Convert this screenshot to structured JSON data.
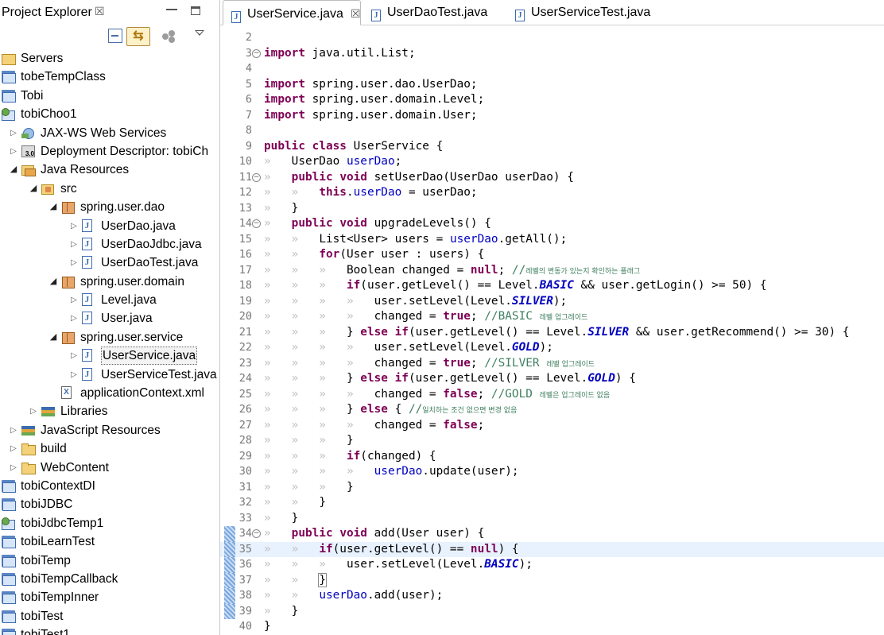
{
  "explorer": {
    "title": "Project Explorer",
    "tree": [
      {
        "label": "Servers",
        "icon": "server-folder",
        "level": 0,
        "twisty": "none"
      },
      {
        "label": "tobeTempClass",
        "icon": "folder-project",
        "level": 0,
        "twisty": "none"
      },
      {
        "label": "Tobi",
        "icon": "folder-project",
        "level": 0,
        "twisty": "none"
      },
      {
        "label": "tobiChoo1",
        "icon": "web-project",
        "level": 0,
        "twisty": "none"
      },
      {
        "label": "JAX-WS Web Services",
        "icon": "jaxws",
        "level": 1,
        "twisty": "collapsed"
      },
      {
        "label": "Deployment Descriptor: tobiCh",
        "icon": "descriptor",
        "level": 1,
        "twisty": "collapsed"
      },
      {
        "label": "Java Resources",
        "icon": "java-res",
        "level": 1,
        "twisty": "expanded"
      },
      {
        "label": "src",
        "icon": "src-folder",
        "level": 2,
        "twisty": "expanded"
      },
      {
        "label": "spring.user.dao",
        "icon": "package",
        "level": 3,
        "twisty": "expanded"
      },
      {
        "label": "UserDao.java",
        "icon": "java-file",
        "level": 4,
        "twisty": "collapsed"
      },
      {
        "label": "UserDaoJdbc.java",
        "icon": "java-file",
        "level": 4,
        "twisty": "collapsed"
      },
      {
        "label": "UserDaoTest.java",
        "icon": "java-file",
        "level": 4,
        "twisty": "collapsed"
      },
      {
        "label": "spring.user.domain",
        "icon": "package",
        "level": 3,
        "twisty": "expanded"
      },
      {
        "label": "Level.java",
        "icon": "java-file",
        "level": 4,
        "twisty": "collapsed"
      },
      {
        "label": "User.java",
        "icon": "java-file",
        "level": 4,
        "twisty": "collapsed"
      },
      {
        "label": "spring.user.service",
        "icon": "package",
        "level": 3,
        "twisty": "expanded"
      },
      {
        "label": "UserService.java",
        "icon": "java-file",
        "level": 4,
        "twisty": "collapsed",
        "selected": true
      },
      {
        "label": "UserServiceTest.java",
        "icon": "java-file",
        "level": 4,
        "twisty": "collapsed"
      },
      {
        "label": "applicationContext.xml",
        "icon": "xml-file",
        "level": 3,
        "twisty": "none"
      },
      {
        "label": "Libraries",
        "icon": "library",
        "level": 2,
        "twisty": "collapsed"
      },
      {
        "label": "JavaScript Resources",
        "icon": "js-res",
        "level": 1,
        "twisty": "collapsed"
      },
      {
        "label": "build",
        "icon": "closed-folder",
        "level": 1,
        "twisty": "collapsed"
      },
      {
        "label": "WebContent",
        "icon": "closed-folder",
        "level": 1,
        "twisty": "collapsed"
      },
      {
        "label": "tobiContextDI",
        "icon": "folder-project",
        "level": 0,
        "twisty": "none"
      },
      {
        "label": "tobiJDBC",
        "icon": "folder-project",
        "level": 0,
        "twisty": "none"
      },
      {
        "label": "tobiJdbcTemp1",
        "icon": "web-project",
        "level": 0,
        "twisty": "none"
      },
      {
        "label": "tobiLearnTest",
        "icon": "folder-project",
        "level": 0,
        "twisty": "none"
      },
      {
        "label": "tobiTemp",
        "icon": "folder-project",
        "level": 0,
        "twisty": "none"
      },
      {
        "label": "tobiTempCallback",
        "icon": "folder-project",
        "level": 0,
        "twisty": "none"
      },
      {
        "label": "tobiTempInner",
        "icon": "folder-project",
        "level": 0,
        "twisty": "none"
      },
      {
        "label": "tobiTest",
        "icon": "folder-project",
        "level": 0,
        "twisty": "none"
      },
      {
        "label": "tobiTest1",
        "icon": "folder-project",
        "level": 0,
        "twisty": "none"
      }
    ]
  },
  "editor": {
    "tabs": [
      {
        "label": "UserService.java",
        "active": true,
        "closable": true
      },
      {
        "label": "UserDaoTest.java",
        "active": false,
        "closable": false
      },
      {
        "label": "UserServiceTest.java",
        "active": false,
        "closable": false
      }
    ],
    "current_line": 35,
    "lines": [
      {
        "n": 2,
        "t": []
      },
      {
        "n": 3,
        "fold": "minus",
        "t": [
          [
            "kw",
            "import"
          ],
          [
            "p",
            " java.util.List;"
          ]
        ]
      },
      {
        "n": 4,
        "t": []
      },
      {
        "n": 5,
        "t": [
          [
            "kw",
            "import"
          ],
          [
            "p",
            " spring.user.dao.UserDao;"
          ]
        ]
      },
      {
        "n": 6,
        "t": [
          [
            "kw",
            "import"
          ],
          [
            "p",
            " spring.user.domain.Level;"
          ]
        ]
      },
      {
        "n": 7,
        "t": [
          [
            "kw",
            "import"
          ],
          [
            "p",
            " spring.user.domain.User;"
          ]
        ]
      },
      {
        "n": 8,
        "t": []
      },
      {
        "n": 9,
        "t": [
          [
            "kw",
            "public"
          ],
          [
            "p",
            " "
          ],
          [
            "kw",
            "class"
          ],
          [
            "p",
            " UserService {"
          ]
        ]
      },
      {
        "n": 10,
        "t": [
          [
            "tab",
            "»   "
          ],
          [
            "p",
            "UserDao "
          ],
          [
            "fld",
            "userDao"
          ],
          [
            "p",
            ";"
          ]
        ]
      },
      {
        "n": 11,
        "fold": "minus",
        "t": [
          [
            "tab",
            "»   "
          ],
          [
            "kw",
            "public"
          ],
          [
            "p",
            " "
          ],
          [
            "kw",
            "void"
          ],
          [
            "p",
            " setUserDao(UserDao userDao) {"
          ]
        ]
      },
      {
        "n": 12,
        "t": [
          [
            "tab",
            "»   »   "
          ],
          [
            "kw",
            "this"
          ],
          [
            "p",
            "."
          ],
          [
            "fld",
            "userDao"
          ],
          [
            "p",
            " = userDao;"
          ]
        ]
      },
      {
        "n": 13,
        "t": [
          [
            "tab",
            "»   "
          ],
          [
            "p",
            "}"
          ]
        ]
      },
      {
        "n": 14,
        "fold": "minus",
        "t": [
          [
            "tab",
            "»   "
          ],
          [
            "kw",
            "public"
          ],
          [
            "p",
            " "
          ],
          [
            "kw",
            "void"
          ],
          [
            "p",
            " upgradeLevels() {"
          ]
        ]
      },
      {
        "n": 15,
        "t": [
          [
            "tab",
            "»   »   "
          ],
          [
            "p",
            "List<User> users = "
          ],
          [
            "fld",
            "userDao"
          ],
          [
            "p",
            ".getAll();"
          ]
        ]
      },
      {
        "n": 16,
        "t": [
          [
            "tab",
            "»   »   "
          ],
          [
            "kw",
            "for"
          ],
          [
            "p",
            "(User user : users) {"
          ]
        ]
      },
      {
        "n": 17,
        "t": [
          [
            "tab",
            "»   »   »   "
          ],
          [
            "p",
            "Boolean changed = "
          ],
          [
            "kw",
            "null"
          ],
          [
            "p",
            "; "
          ],
          [
            "cmt",
            "//"
          ],
          [
            "ctext",
            "레벨의 변동가 있는지 확인하는 플래그"
          ]
        ]
      },
      {
        "n": 18,
        "t": [
          [
            "tab",
            "»   »   »   "
          ],
          [
            "kw",
            "if"
          ],
          [
            "p",
            "(user.getLevel() == Level."
          ],
          [
            "sfld",
            "BASIC"
          ],
          [
            "p",
            " && user.getLogin() >= 50) {"
          ]
        ]
      },
      {
        "n": 19,
        "t": [
          [
            "tab",
            "»   »   »   »   "
          ],
          [
            "p",
            "user.setLevel(Level."
          ],
          [
            "sfld",
            "SILVER"
          ],
          [
            "p",
            ");"
          ]
        ]
      },
      {
        "n": 20,
        "t": [
          [
            "tab",
            "»   »   »   »   "
          ],
          [
            "p",
            "changed = "
          ],
          [
            "kw",
            "true"
          ],
          [
            "p",
            "; "
          ],
          [
            "cmt",
            "//BASIC "
          ],
          [
            "ctext",
            "레벨 업그레이드"
          ]
        ]
      },
      {
        "n": 21,
        "t": [
          [
            "tab",
            "»   »   »   "
          ],
          [
            "p",
            "} "
          ],
          [
            "kw",
            "else"
          ],
          [
            "p",
            " "
          ],
          [
            "kw",
            "if"
          ],
          [
            "p",
            "(user.getLevel() == Level."
          ],
          [
            "sfld",
            "SILVER"
          ],
          [
            "p",
            " && user.getRecommend() >= 30) {"
          ]
        ]
      },
      {
        "n": 22,
        "t": [
          [
            "tab",
            "»   »   »   »   "
          ],
          [
            "p",
            "user.setLevel(Level."
          ],
          [
            "sfld",
            "GOLD"
          ],
          [
            "p",
            ");"
          ]
        ]
      },
      {
        "n": 23,
        "t": [
          [
            "tab",
            "»   »   »   »   "
          ],
          [
            "p",
            "changed = "
          ],
          [
            "kw",
            "true"
          ],
          [
            "p",
            "; "
          ],
          [
            "cmt",
            "//SILVER "
          ],
          [
            "ctext",
            "레벨 업그레이드"
          ]
        ]
      },
      {
        "n": 24,
        "t": [
          [
            "tab",
            "»   »   »   "
          ],
          [
            "p",
            "} "
          ],
          [
            "kw",
            "else"
          ],
          [
            "p",
            " "
          ],
          [
            "kw",
            "if"
          ],
          [
            "p",
            "(user.getLevel() == Level."
          ],
          [
            "sfld",
            "GOLD"
          ],
          [
            "p",
            ") {"
          ]
        ]
      },
      {
        "n": 25,
        "t": [
          [
            "tab",
            "»   »   »   »   "
          ],
          [
            "p",
            "changed = "
          ],
          [
            "kw",
            "false"
          ],
          [
            "p",
            "; "
          ],
          [
            "cmt",
            "//GOLD "
          ],
          [
            "ctext",
            "레벨은 업그레이드 없음"
          ]
        ]
      },
      {
        "n": 26,
        "t": [
          [
            "tab",
            "»   »   »   "
          ],
          [
            "p",
            "} "
          ],
          [
            "kw",
            "else"
          ],
          [
            "p",
            " { "
          ],
          [
            "cmt",
            "//"
          ],
          [
            "ctext",
            "일치하는 조건 없으면 변경 없음"
          ]
        ]
      },
      {
        "n": 27,
        "t": [
          [
            "tab",
            "»   »   »   »   "
          ],
          [
            "p",
            "changed = "
          ],
          [
            "kw",
            "false"
          ],
          [
            "p",
            ";"
          ]
        ]
      },
      {
        "n": 28,
        "t": [
          [
            "tab",
            "»   »   »   "
          ],
          [
            "p",
            "}"
          ]
        ]
      },
      {
        "n": 29,
        "t": [
          [
            "tab",
            "»   »   »   "
          ],
          [
            "kw",
            "if"
          ],
          [
            "p",
            "(changed) {"
          ]
        ]
      },
      {
        "n": 30,
        "t": [
          [
            "tab",
            "»   »   »   »   "
          ],
          [
            "fld",
            "userDao"
          ],
          [
            "p",
            ".update(user);"
          ]
        ]
      },
      {
        "n": 31,
        "t": [
          [
            "tab",
            "»   »   »   "
          ],
          [
            "p",
            "}"
          ]
        ]
      },
      {
        "n": 32,
        "t": [
          [
            "tab",
            "»   »   "
          ],
          [
            "p",
            "}"
          ]
        ]
      },
      {
        "n": 33,
        "t": [
          [
            "tab",
            "»   "
          ],
          [
            "p",
            "}"
          ]
        ]
      },
      {
        "n": 34,
        "fold": "minus",
        "mark": true,
        "t": [
          [
            "tab",
            "»   "
          ],
          [
            "kw",
            "public"
          ],
          [
            "p",
            " "
          ],
          [
            "kw",
            "void"
          ],
          [
            "p",
            " add(User user) {"
          ]
        ]
      },
      {
        "n": 35,
        "mark": true,
        "t": [
          [
            "tab",
            "»   »   "
          ],
          [
            "kw",
            "if"
          ],
          [
            "p",
            "(user.getLevel() == "
          ],
          [
            "kw",
            "null"
          ],
          [
            "p",
            ") {"
          ]
        ]
      },
      {
        "n": 36,
        "mark": true,
        "t": [
          [
            "tab",
            "»   »   »   "
          ],
          [
            "p",
            "user.setLevel(Level."
          ],
          [
            "sfld",
            "BASIC"
          ],
          [
            "p",
            ");"
          ]
        ]
      },
      {
        "n": 37,
        "mark": true,
        "t": [
          [
            "tab",
            "»   »   "
          ],
          [
            "box",
            "}"
          ]
        ]
      },
      {
        "n": 38,
        "mark": true,
        "t": [
          [
            "tab",
            "»   »   "
          ],
          [
            "fld",
            "userDao"
          ],
          [
            "p",
            ".add(user);"
          ]
        ]
      },
      {
        "n": 39,
        "mark": true,
        "t": [
          [
            "tab",
            "»   "
          ],
          [
            "p",
            "}"
          ]
        ]
      },
      {
        "n": 40,
        "t": [
          [
            "p",
            "}"
          ]
        ]
      }
    ]
  }
}
